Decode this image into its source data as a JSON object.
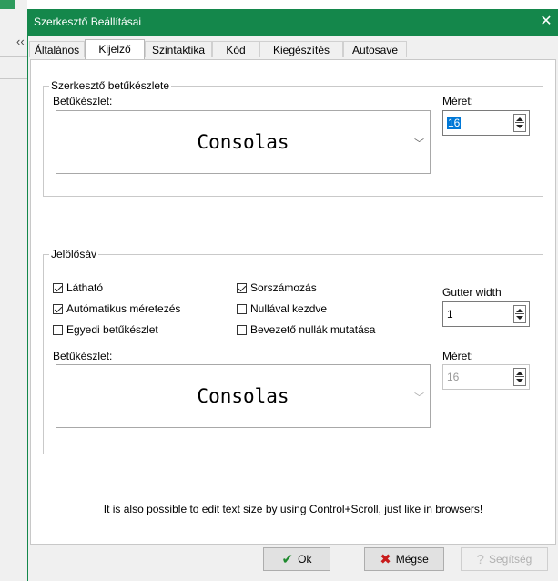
{
  "window": {
    "title": "Szerkesztő Beállításai",
    "close_glyph": "✕"
  },
  "tabs": [
    {
      "label": "Általános"
    },
    {
      "label": "Kijelző",
      "active": true
    },
    {
      "label": "Szintaktika"
    },
    {
      "label": "Kód"
    },
    {
      "label": "Kiegészítés"
    },
    {
      "label": "Autosave"
    }
  ],
  "editor_font": {
    "legend": "Szerkesztő betűkészlete",
    "font_label": "Betűkészlet:",
    "font_value": "Consolas",
    "size_label": "Méret:",
    "size_value": "16"
  },
  "gutter": {
    "legend": "Jelölősáv",
    "checkboxes": [
      {
        "label": "Látható",
        "checked": true
      },
      {
        "label": "Sorszámozás",
        "checked": true
      },
      {
        "label": "Autómatikus méretezés",
        "checked": true
      },
      {
        "label": "Nullával kezdve",
        "checked": false
      },
      {
        "label": "Egyedi betűkészlet",
        "checked": false
      },
      {
        "label": "Bevezető nullák mutatása",
        "checked": false
      }
    ],
    "gutter_width_label": "Gutter width",
    "gutter_width_value": "1",
    "font_label": "Betűkészlet:",
    "font_value": "Consolas",
    "size_label": "Méret:",
    "size_value": "16"
  },
  "hint_text": "It is also possible to edit text size by using Control+Scroll, just like in browsers!",
  "buttons": {
    "ok": "Ok",
    "cancel": "Mégse",
    "help": "Segítség"
  },
  "colors": {
    "titlebar": "#14874b",
    "ok_icon": "#1e8a2e",
    "cancel_icon": "#c81b1b",
    "selection": "#0078d7"
  },
  "icons": {
    "ok": "check-icon",
    "cancel": "x-icon",
    "help": "help-icon",
    "dropdown": "chevron-down-icon"
  }
}
